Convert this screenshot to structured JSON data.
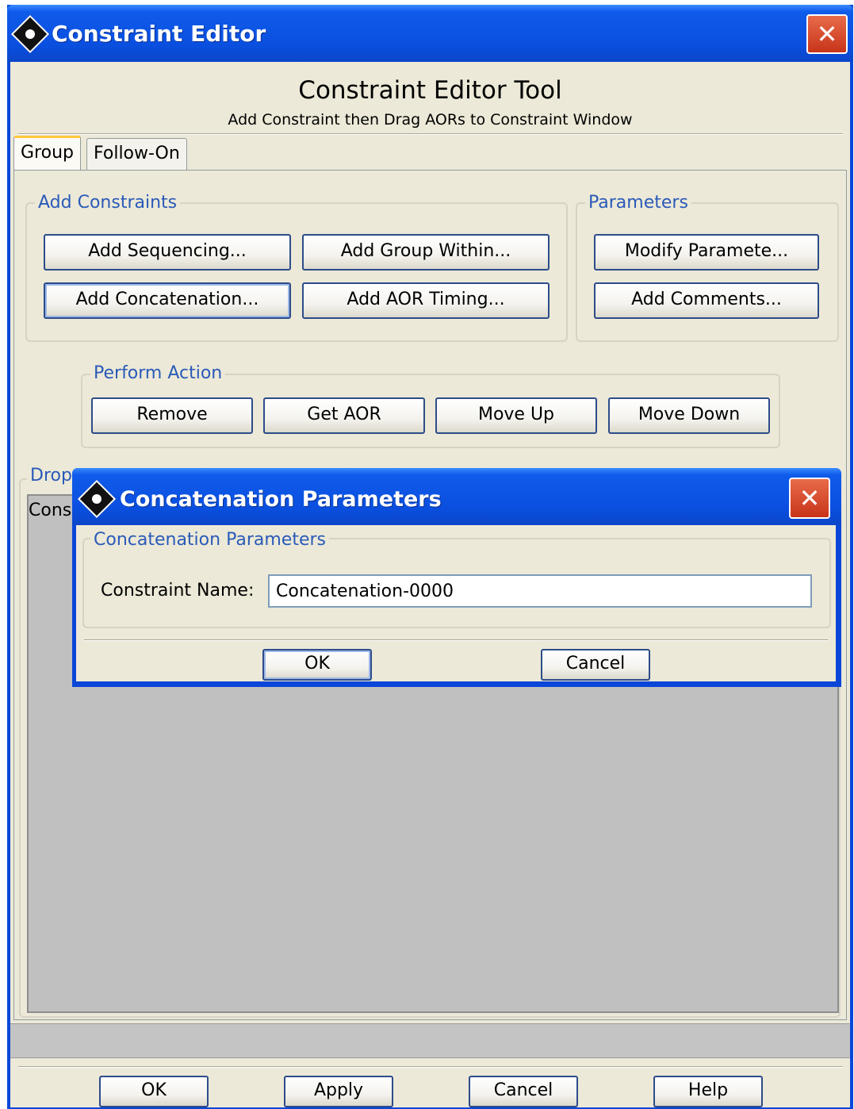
{
  "main_window": {
    "title": "Constraint Editor",
    "heading": "Constraint Editor Tool",
    "subheading": "Add Constraint then Drag AORs to Constraint Window",
    "close_glyph": "✕",
    "tabs": [
      {
        "label": "Group",
        "active": true
      },
      {
        "label": "Follow-On",
        "active": false
      }
    ],
    "add_constraints": {
      "label": "Add Constraints",
      "buttons": [
        "Add Sequencing...",
        "Add Group Within...",
        "Add Concatenation...",
        "Add AOR Timing..."
      ]
    },
    "parameters": {
      "label": "Parameters",
      "buttons": [
        "Modify Paramete...",
        "Add Comments..."
      ]
    },
    "perform_action": {
      "label": "Perform Action",
      "buttons": [
        "Remove",
        "Get AOR",
        "Move Up",
        "Move Down"
      ]
    },
    "drop_area": {
      "label_partial": "Drop",
      "column_partial": "Cons"
    },
    "footer_buttons": [
      "OK",
      "Apply",
      "Cancel",
      "Help"
    ]
  },
  "dialog": {
    "title": "Concatenation Parameters",
    "close_glyph": "✕",
    "group_label": "Concatenation Parameters",
    "constraint_name_label": "Constraint Name:",
    "constraint_name_value": "Concatenation-0000",
    "ok_label": "OK",
    "cancel_label": "Cancel"
  },
  "colors": {
    "titlebar_blue": "#0a4fe0",
    "window_face": "#ece9d8",
    "group_label_blue": "#2a5ab8",
    "close_red": "#c8341a"
  },
  "icons": [
    "app-diamond-icon",
    "close-icon"
  ]
}
